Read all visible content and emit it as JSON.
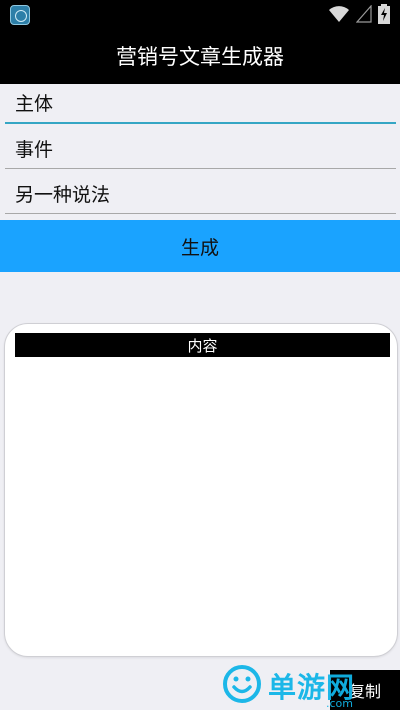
{
  "title_bar": {
    "title": "营销号文章生成器"
  },
  "form": {
    "subject_value": "主体",
    "event_value": "事件",
    "alt_value": "另一种说法"
  },
  "generate_label": "生成",
  "content": {
    "header": "内容",
    "text": ""
  },
  "copy_label": "复制",
  "watermark": {
    "text": "单游网",
    "domain": ".com"
  },
  "colors": {
    "accent": "#1aa3ff",
    "focus_underline": "#35a6c4",
    "watermark": "#11b5e8"
  },
  "icons": [
    "app-icon",
    "wifi-icon",
    "signal-icon",
    "battery-charging-icon",
    "smiley-logo-icon"
  ]
}
